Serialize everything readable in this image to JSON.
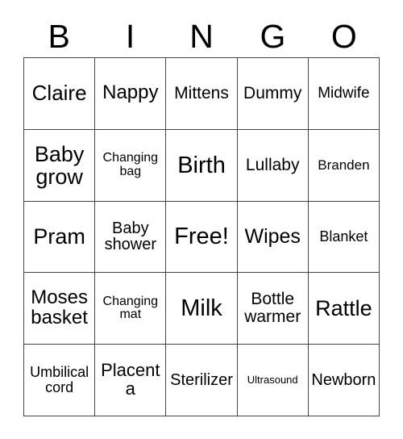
{
  "card": {
    "title": "BINGO",
    "header_letters": [
      "B",
      "I",
      "N",
      "G",
      "O"
    ],
    "free_space_label": "Free!",
    "colors": {
      "background": "#ffffff",
      "text": "#000000",
      "grid_line": "#444444"
    },
    "rows": [
      [
        {
          "label": "Claire",
          "size": "fs-26"
        },
        {
          "label": "Nappy",
          "size": "fs-24"
        },
        {
          "label": "Mittens",
          "size": "fs-21"
        },
        {
          "label": "Dummy",
          "size": "fs-21"
        },
        {
          "label": "Midwife",
          "size": "fs-19"
        }
      ],
      [
        {
          "label": "Baby\ngrow",
          "size": "fs-27"
        },
        {
          "label": "Changing\nbag",
          "size": "fs-16"
        },
        {
          "label": "Birth",
          "size": "fs-29"
        },
        {
          "label": "Lullaby",
          "size": "fs-21"
        },
        {
          "label": "Branden",
          "size": "fs-17"
        }
      ],
      [
        {
          "label": "Pram",
          "size": "fs-27"
        },
        {
          "label": "Baby\nshower",
          "size": "fs-20"
        },
        {
          "label": "Free!",
          "size": "fs-29"
        },
        {
          "label": "Wipes",
          "size": "fs-25"
        },
        {
          "label": "Blanket",
          "size": "fs-18"
        }
      ],
      [
        {
          "label": "Moses\nbasket",
          "size": "fs-24"
        },
        {
          "label": "Changing\nmat",
          "size": "fs-16"
        },
        {
          "label": "Milk",
          "size": "fs-29"
        },
        {
          "label": "Bottle\nwarmer",
          "size": "fs-21"
        },
        {
          "label": "Rattle",
          "size": "fs-27"
        }
      ],
      [
        {
          "label": "Umbilical\ncord",
          "size": "fs-18"
        },
        {
          "label": "Placenta",
          "size": "fs-22"
        },
        {
          "label": "Sterilizer",
          "size": "fs-20"
        },
        {
          "label": "Ultrasound",
          "size": "fs-13"
        },
        {
          "label": "Newborn",
          "size": "fs-20"
        }
      ]
    ]
  }
}
